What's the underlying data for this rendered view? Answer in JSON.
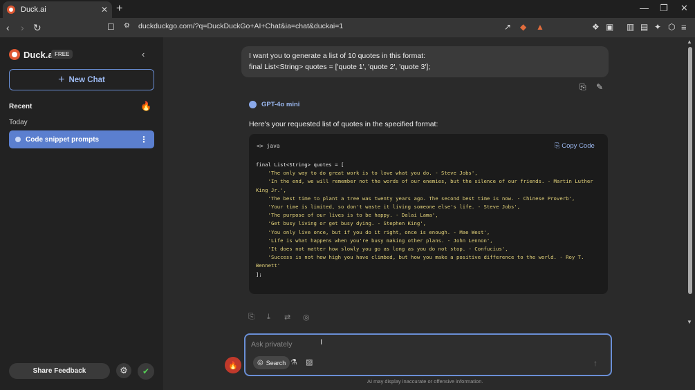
{
  "browser": {
    "tab_title": "Duck.ai",
    "tab_close": "✕",
    "new_tab": "+",
    "url": "duckduckgo.com/?q=DuckDuckGo+AI+Chat&ia=chat&duckai=1",
    "window_controls": {
      "minimize": "—",
      "restore": "❐",
      "close": "✕"
    }
  },
  "sidebar": {
    "brand": "Duck.ai",
    "badge": "FREE",
    "new_chat": "New Chat",
    "recent_label": "Recent",
    "today_label": "Today",
    "chat_item": "Code snippet prompts",
    "share_feedback": "Share Feedback"
  },
  "chat": {
    "user_message_line1": "I want you to generate a list of 10 quotes in this format:",
    "user_message_line2": "final List<String> quotes = ['quote 1', 'quote 2', 'quote 3'];",
    "model_name": "GPT-4o mini",
    "intro": "Here's your requested list of quotes in the specified format:",
    "code_lang": "<> java",
    "copy_code": "Copy Code",
    "code_lines": [
      "final List<String> quotes = [",
      "    'The only way to do great work is to love what you do. - Steve Jobs',",
      "    'In the end, we will remember not the words of our enemies, but the silence of our friends. - Martin Luther King Jr.',",
      "    'The best time to plant a tree was twenty years ago. The second best time is now. - Chinese Proverb',",
      "    'Your time is limited, so don't waste it living someone else's life. - Steve Jobs',",
      "    'The purpose of our lives is to be happy. - Dalai Lama',",
      "    'Get busy living or get busy dying. - Stephen King',",
      "    'You only live once, but if you do it right, once is enough. - Mae West',",
      "    'Life is what happens when you're busy making other plans. - John Lennon',",
      "    'It does not matter how slowly you go as long as you do not stop. - Confucius',",
      "    'Success is not how high you have climbed, but how you make a positive difference to the world. - Roy T. Bennett'",
      "];"
    ]
  },
  "composer": {
    "placeholder": "Ask privately",
    "search_label": "Search",
    "disclaimer": "AI may display inaccurate or offensive information."
  },
  "colors": {
    "accent": "#6a8fd6",
    "brand": "#de5833",
    "code_string": "#e3d27a"
  }
}
